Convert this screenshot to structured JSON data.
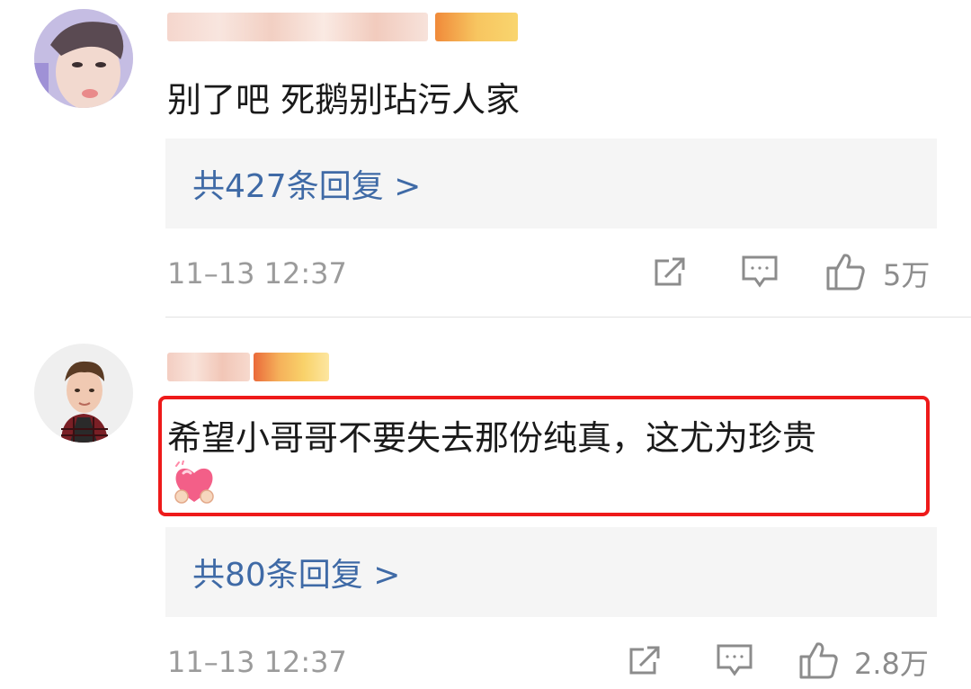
{
  "comments": [
    {
      "text": "别了吧 死鹅别玷污人家",
      "replies_label": "共427条回复 >",
      "time": "11–13 12:37",
      "likes": "5万"
    },
    {
      "text_line1": "希望小哥哥不要失去那份纯真，这尤为珍贵",
      "emoji": "heart-hug-emoji",
      "replies_label": "共80条回复 >",
      "time": "11–13 12:37",
      "likes": "2.8万"
    }
  ],
  "colors": {
    "link": "#3f6aa6",
    "highlight": "#ee1a1a",
    "muted": "#9b9b9b"
  },
  "icons": [
    "share-icon",
    "comment-icon",
    "like-icon"
  ]
}
